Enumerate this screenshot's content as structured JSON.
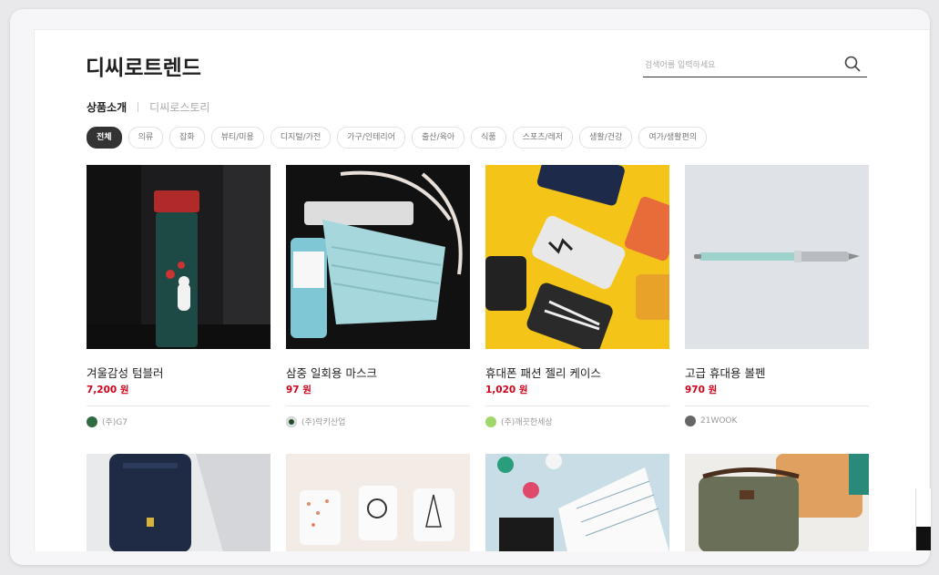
{
  "header": {
    "brand": "디씨로트렌드",
    "search_placeholder": "검색어를 입력하세요"
  },
  "subnav": {
    "active": "상품소개",
    "inactive": "디씨로스토리"
  },
  "categories": [
    "전체",
    "의류",
    "잡화",
    "뷰티/미용",
    "디지털/가전",
    "가구/인테리어",
    "출산/육아",
    "식품",
    "스포츠/레저",
    "생활/건강",
    "여가/생활편의"
  ],
  "selected_category": "전체",
  "products": [
    {
      "title": "겨울감성 텀블러",
      "price": "7,200 원",
      "seller": "(주)G7",
      "avatar_color": "#2f6b3e"
    },
    {
      "title": "삼중 일회용 마스크",
      "price": "97 원",
      "seller": "(주)락키산업",
      "avatar_color": "#1f4d2a"
    },
    {
      "title": "휴대폰 패션 젤리 케이스",
      "price": "1,020 원",
      "seller": "(주)깨끗한세상",
      "avatar_color": "#9fd86a"
    },
    {
      "title": "고급 휴대용 볼펜",
      "price": "970 원",
      "seller": "21WOOK",
      "avatar_color": "#666666"
    }
  ],
  "icons": {
    "search": "search-icon"
  },
  "colors": {
    "price": "#d0021b",
    "chip_selected_bg": "#333333"
  }
}
